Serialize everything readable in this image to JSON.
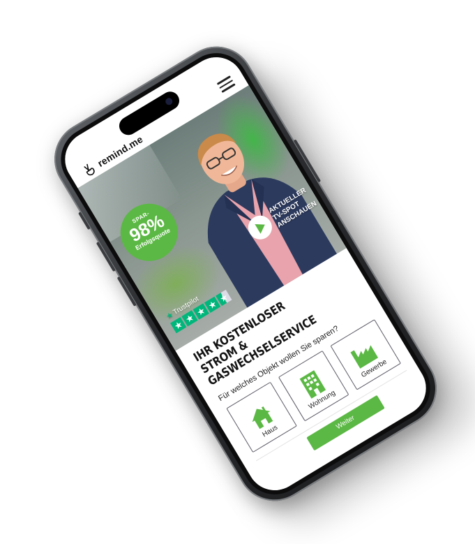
{
  "brand": {
    "name": "remind.me",
    "accent": "#5bb844",
    "trustpilot_green": "#00b67a"
  },
  "header": {
    "logo_icon": "fingers-crossed-logo-icon",
    "menu_icon": "hamburger-menu-icon"
  },
  "hero": {
    "badge": {
      "top": "SPAR-",
      "value": "98%",
      "sub": "Erfolgsquote"
    },
    "tv_spot": {
      "line1": "AKTUELLER",
      "line2": "TV-SPOT ANSCHAUEN",
      "icon": "play-icon"
    },
    "trustpilot": {
      "label": "Trustpilot",
      "rating_stars": 4.5
    }
  },
  "main": {
    "headline": {
      "line1": "IHR KOSTENLOSER",
      "line2": "STROM &",
      "line3": "GASWECHSELSERVICE"
    },
    "question": "Für welches Objekt wollen Sie sparen?",
    "options": [
      {
        "label": "Haus",
        "icon": "house-icon"
      },
      {
        "label": "Wohnung",
        "icon": "apartment-building-icon"
      },
      {
        "label": "Gewerbe",
        "icon": "factory-icon"
      }
    ],
    "submit_label": "Weiter"
  }
}
